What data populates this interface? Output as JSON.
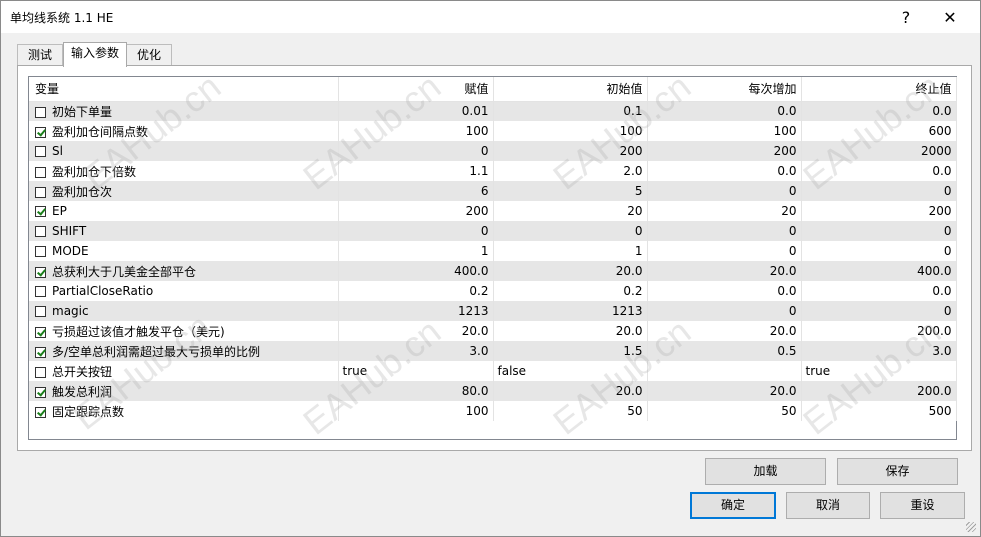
{
  "window": {
    "title": "单均线系统 1.1 HE",
    "help_glyph": "?",
    "close_glyph": "✕"
  },
  "tabs": [
    {
      "label": "测试"
    },
    {
      "label": "输入参数"
    },
    {
      "label": "优化"
    }
  ],
  "table": {
    "headers": [
      "变量",
      "赋值",
      "初始值",
      "每次增加",
      "终止值"
    ],
    "rows": [
      {
        "checked": false,
        "name": "初始下单量",
        "value": "0.01",
        "start": "0.1",
        "step": "0.0",
        "stop": "0.0"
      },
      {
        "checked": true,
        "name": "盈利加仓间隔点数",
        "value": "100",
        "start": "100",
        "step": "100",
        "stop": "600"
      },
      {
        "checked": false,
        "name": "Sl",
        "value": "0",
        "start": "200",
        "step": "200",
        "stop": "2000"
      },
      {
        "checked": false,
        "name": "盈利加仓下倍数",
        "value": "1.1",
        "start": "2.0",
        "step": "0.0",
        "stop": "0.0"
      },
      {
        "checked": false,
        "name": "盈利加仓次",
        "value": "6",
        "start": "5",
        "step": "0",
        "stop": "0"
      },
      {
        "checked": true,
        "name": "EP",
        "value": "200",
        "start": "20",
        "step": "20",
        "stop": "200"
      },
      {
        "checked": false,
        "name": "SHIFT",
        "value": "0",
        "start": "0",
        "step": "0",
        "stop": "0"
      },
      {
        "checked": false,
        "name": "MODE",
        "value": "1",
        "start": "1",
        "step": "0",
        "stop": "0"
      },
      {
        "checked": true,
        "name": "总获利大于几美金全部平仓",
        "value": "400.0",
        "start": "20.0",
        "step": "20.0",
        "stop": "400.0"
      },
      {
        "checked": false,
        "name": "PartialCloseRatio",
        "value": "0.2",
        "start": "0.2",
        "step": "0.0",
        "stop": "0.0"
      },
      {
        "checked": false,
        "name": "magic",
        "value": "1213",
        "start": "1213",
        "step": "0",
        "stop": "0"
      },
      {
        "checked": true,
        "name": "亏损超过该值才触发平仓（美元)",
        "value": "20.0",
        "start": "20.0",
        "step": "20.0",
        "stop": "200.0"
      },
      {
        "checked": true,
        "name": "多/空单总利润需超过最大亏损单的比例",
        "value": "3.0",
        "start": "1.5",
        "step": "0.5",
        "stop": "3.0"
      },
      {
        "checked": false,
        "name": "总开关按钮",
        "value": "true",
        "start": "false",
        "step": "",
        "stop": "true",
        "textual": true
      },
      {
        "checked": true,
        "name": "触发总利润",
        "value": "80.0",
        "start": "20.0",
        "step": "20.0",
        "stop": "200.0"
      },
      {
        "checked": true,
        "name": "固定跟踪点数",
        "value": "100",
        "start": "50",
        "step": "50",
        "stop": "500"
      }
    ]
  },
  "buttons": {
    "load": "加载",
    "save": "保存",
    "ok": "确定",
    "cancel": "取消",
    "reset": "重设"
  },
  "watermark": "EAHub.cn",
  "colors": {
    "accent": "#0078d7",
    "check": "#1a7f1a",
    "alt_row": "#e6e6e6"
  }
}
